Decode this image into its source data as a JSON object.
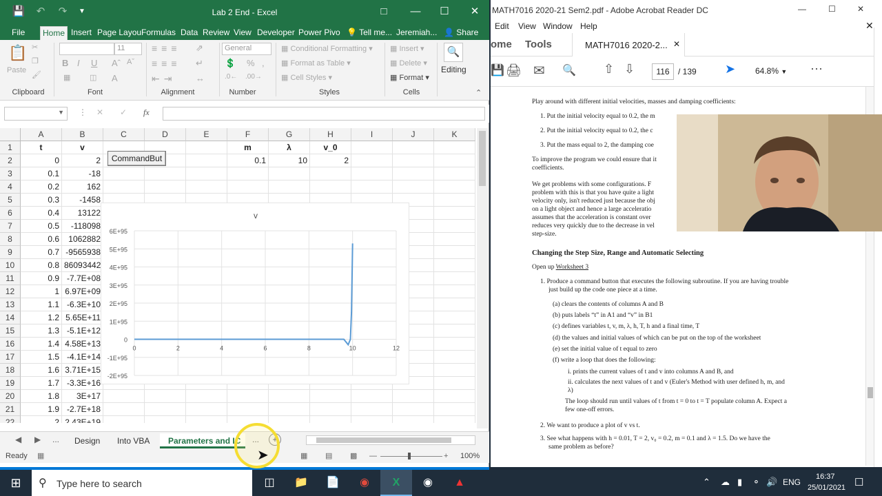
{
  "excel": {
    "title": "Lab 2 End - Excel",
    "tabs": [
      "File",
      "Home",
      "Insert",
      "Page Layou",
      "Formulas",
      "Data",
      "Review",
      "View",
      "Developer",
      "Power Pivo",
      "Tell me...",
      "Jeremiah...",
      "Share"
    ],
    "ribbon": {
      "paste": "Paste",
      "clipboard": "Clipboard",
      "font": "Font",
      "font_size": "11",
      "alignment": "Alignment",
      "number_format": "General",
      "number": "Number",
      "conditional_formatting": "Conditional Formatting",
      "format_as_table": "Format as Table",
      "cell_styles": "Cell Styles",
      "styles": "Styles",
      "insert": "Insert",
      "delete": "Delete",
      "format": "Format",
      "cells": "Cells",
      "editing": "Editing"
    },
    "fx": "fx",
    "columns": [
      "A",
      "B",
      "C",
      "D",
      "E",
      "F",
      "G",
      "H",
      "I",
      "J",
      "K"
    ],
    "rows": [
      "1",
      "2",
      "3",
      "4",
      "5",
      "6",
      "7",
      "8",
      "9",
      "10",
      "11",
      "12",
      "13",
      "14",
      "15",
      "16",
      "17",
      "18",
      "19",
      "20",
      "21",
      "22"
    ],
    "colA": [
      "t",
      "0",
      "0.1",
      "0.2",
      "0.3",
      "0.4",
      "0.5",
      "0.6",
      "0.7",
      "0.8",
      "0.9",
      "1",
      "1.1",
      "1.2",
      "1.3",
      "1.4",
      "1.5",
      "1.6",
      "1.7",
      "1.8",
      "1.9",
      "2"
    ],
    "colB": [
      "v",
      "2",
      "-18",
      "162",
      "-1458",
      "13122",
      "-118098",
      "1062882",
      "-9565938",
      "86093442",
      "-7.7E+08",
      "6.97E+09",
      "-6.3E+10",
      "5.65E+11",
      "-5.1E+12",
      "4.58E+13",
      "-4.1E+14",
      "3.71E+15",
      "-3.3E+16",
      "3E+17",
      "-2.7E+18",
      "2.43E+19"
    ],
    "params": {
      "m_label": "m",
      "lambda_label": "λ",
      "v0_label": "v_0",
      "m": "0.1",
      "lambda": "10",
      "v0": "2"
    },
    "command_button": "CommandBut",
    "sheets": [
      "Design",
      "Into VBA",
      "Parameters and IC",
      "..."
    ],
    "status": "Ready",
    "zoom": "100%"
  },
  "chart_data": {
    "type": "line",
    "title": "v",
    "x": [
      0,
      1,
      2,
      3,
      4,
      5,
      6,
      7,
      8,
      9,
      9.6,
      9.8,
      9.9,
      9.95,
      10
    ],
    "y": [
      0,
      0,
      0,
      0,
      0,
      0,
      0,
      0,
      0,
      0,
      0,
      -3e+94,
      0,
      1.5e+95,
      5.3e+95
    ],
    "xlim": [
      0,
      12
    ],
    "ylim": [
      -2e+95,
      6e+95
    ],
    "xticks": [
      "0",
      "2",
      "4",
      "6",
      "8",
      "10",
      "12"
    ],
    "yticks": [
      "6E+95",
      "5E+95",
      "4E+95",
      "3E+95",
      "2E+95",
      "1E+95",
      "0",
      "-1E+95",
      "-2E+95"
    ],
    "color": "#5b9bd5"
  },
  "acrobat": {
    "title": "MATH7016 2020-21 Sem2.pdf - Adobe Acrobat Reader DC",
    "menu": [
      "Edit",
      "View",
      "Window",
      "Help"
    ],
    "tabs": [
      "ome",
      "Tools",
      "MATH7016 2020-2..."
    ],
    "page_current": "116",
    "page_total": "/ 139",
    "zoom": "64.8%",
    "doc": {
      "intro": "Play around with different initial velocities, masses and damping coefficients:",
      "items": [
        "1. Put the initial velocity equal to 0.2, the m",
        "2. Put the initial velocity equal to 0.2, the c",
        "3. Put the mass equal to 2, the damping coe"
      ],
      "improve": [
        "To improve the program we could ensure that it",
        "coefficients."
      ],
      "problems": [
        "We get problems with some configurations.  F",
        "problem with this is that you have quite a light",
        "velocity only, isn't reduced just because the obj",
        "on a light object and hence a large acceleratio",
        "assumes that the acceleration is constant over",
        "reduces very quickly due to the decrease in vel",
        "step-size."
      ],
      "heading": "Changing the Step Size, Range and Automatic Selecting",
      "open_up": "Open up ",
      "worksheet": "Worksheet 3",
      "task1": [
        "1. Produce a command button that executes the following subroutine. If you are having trouble",
        "just build up the code one piece at a time."
      ],
      "subitems": [
        "(a)  clears the contents of columns A and B",
        "(b)  puts labels “t” in A1 and “v” in B1",
        "(c)  defines variables t, v, m, λ, h, T, h and a final time, T",
        "(d)  the values and initial values of which can be put on the top of the worksheet",
        "(e)  set the initial value of t equal to zero",
        "(f)  write a loop that does the following:"
      ],
      "loop": [
        "i.  prints the current values of t and v into columns A and B, and",
        "ii.  calculates the next values of t and v (Euler's Method with user defined h, m, and",
        "      λ)"
      ],
      "loopnote": [
        "The loop should run until values of t from t = 0 to t = T populate column A. Expect a",
        "few one-off errors."
      ],
      "task2": "2. We want to produce a plot of v vs t.",
      "task3": [
        "3. See what happens with h = 0.01, T = 2, v₀ = 0.2, m = 0.1 and λ = 1.5.  Do we have the",
        "same problem as before?"
      ]
    }
  },
  "taskbar": {
    "search": "Type here to search",
    "time": "16:37",
    "date": "25/01/2021",
    "lang": "ENG"
  }
}
